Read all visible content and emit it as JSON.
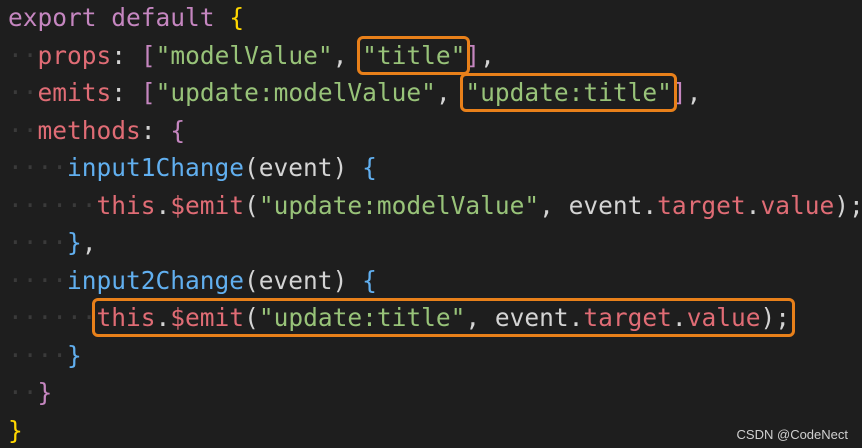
{
  "colors": {
    "background": "#1e1e1e",
    "keyword": "#c586c0",
    "keyword_alt": "#569cd6",
    "string": "#98c379",
    "function": "#61afef",
    "property": "#e06c75",
    "punctuation": "#d4d4d4",
    "bracket": "#ffd700",
    "highlight": "#e8801a"
  },
  "code": {
    "lines": [
      [
        {
          "t": "export",
          "c": "kw"
        },
        {
          "t": " "
        },
        {
          "t": "default",
          "c": "kw"
        },
        {
          "t": " "
        },
        {
          "t": "{",
          "c": "br"
        }
      ],
      [
        {
          "t": "··",
          "c": "ws"
        },
        {
          "t": "props",
          "c": "prop"
        },
        {
          "t": ":",
          "c": "p"
        },
        {
          "t": " "
        },
        {
          "t": "[",
          "c": "br2"
        },
        {
          "t": "\"modelValue\"",
          "c": "str"
        },
        {
          "t": ",",
          "c": "p"
        },
        {
          "t": " "
        },
        {
          "t": "\"title\"",
          "c": "str",
          "hl": true
        },
        {
          "t": "]",
          "c": "br2"
        },
        {
          "t": ",",
          "c": "p"
        }
      ],
      [
        {
          "t": "··",
          "c": "ws"
        },
        {
          "t": "emits",
          "c": "prop"
        },
        {
          "t": ":",
          "c": "p"
        },
        {
          "t": " "
        },
        {
          "t": "[",
          "c": "br2"
        },
        {
          "t": "\"update:modelValue\"",
          "c": "str"
        },
        {
          "t": ",",
          "c": "p"
        },
        {
          "t": " "
        },
        {
          "t": "\"update:title\"",
          "c": "str",
          "hl": true
        },
        {
          "t": "]",
          "c": "br2"
        },
        {
          "t": ",",
          "c": "p"
        }
      ],
      [
        {
          "t": "··",
          "c": "ws"
        },
        {
          "t": "methods",
          "c": "prop"
        },
        {
          "t": ":",
          "c": "p"
        },
        {
          "t": " "
        },
        {
          "t": "{",
          "c": "br2"
        }
      ],
      [
        {
          "t": "····",
          "c": "ws"
        },
        {
          "t": "input1Change",
          "c": "fn"
        },
        {
          "t": "(",
          "c": "p"
        },
        {
          "t": "event",
          "c": "p"
        },
        {
          "t": ")",
          "c": "p"
        },
        {
          "t": " "
        },
        {
          "t": "{",
          "c": "br3"
        }
      ],
      [
        {
          "t": "······",
          "c": "ws"
        },
        {
          "t": "this",
          "c": "this"
        },
        {
          "t": ".",
          "c": "p"
        },
        {
          "t": "$emit",
          "c": "prop"
        },
        {
          "t": "(",
          "c": "p"
        },
        {
          "t": "\"update:modelValue\"",
          "c": "str"
        },
        {
          "t": ",",
          "c": "p"
        },
        {
          "t": " "
        },
        {
          "t": "event",
          "c": "p"
        },
        {
          "t": ".",
          "c": "p"
        },
        {
          "t": "target",
          "c": "prop"
        },
        {
          "t": ".",
          "c": "p"
        },
        {
          "t": "value",
          "c": "prop"
        },
        {
          "t": ")",
          "c": "p"
        },
        {
          "t": ";",
          "c": "p"
        }
      ],
      [
        {
          "t": "····",
          "c": "ws"
        },
        {
          "t": "}",
          "c": "br3"
        },
        {
          "t": ",",
          "c": "p"
        }
      ],
      [
        {
          "t": "····",
          "c": "ws"
        },
        {
          "t": "input2Change",
          "c": "fn"
        },
        {
          "t": "(",
          "c": "p"
        },
        {
          "t": "event",
          "c": "p"
        },
        {
          "t": ")",
          "c": "p"
        },
        {
          "t": " "
        },
        {
          "t": "{",
          "c": "br3"
        }
      ],
      [
        {
          "t": "······",
          "c": "ws"
        },
        {
          "t": "this.$emit(\"update:title\", event.target.value);",
          "c": "mixed",
          "hl": true
        }
      ],
      [
        {
          "t": "····",
          "c": "ws"
        },
        {
          "t": "}",
          "c": "br3"
        }
      ],
      [
        {
          "t": "··",
          "c": "ws"
        },
        {
          "t": "}",
          "c": "br2"
        }
      ],
      [
        {
          "t": "}",
          "c": "br"
        }
      ]
    ]
  },
  "watermark": "CSDN @CodeNect"
}
